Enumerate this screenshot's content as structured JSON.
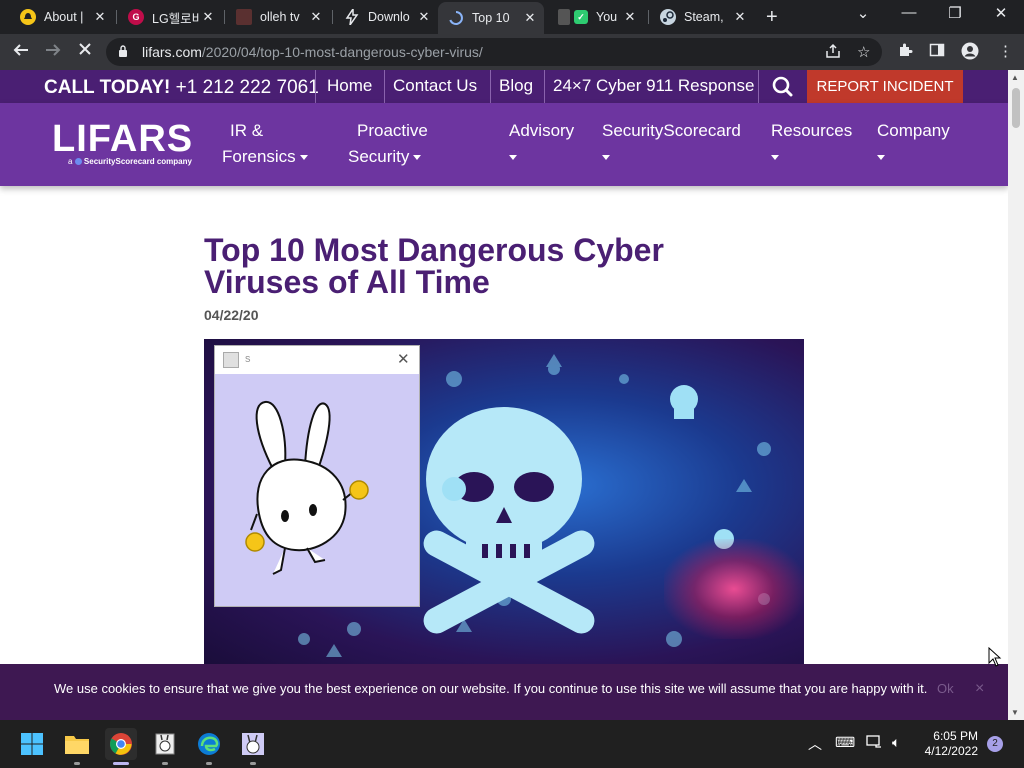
{
  "browser": {
    "tabs": [
      {
        "title": "About |",
        "icon": "bell-icon",
        "color": "#f5c518",
        "active": false
      },
      {
        "title": "LG헬로비",
        "icon": "lg-icon",
        "color": "#c00d4a",
        "active": false
      },
      {
        "title": "olleh tv",
        "icon": "olleh-icon",
        "color": "#c0392b",
        "active": false
      },
      {
        "title": "Downlo",
        "icon": "lightning-icon",
        "color": "#e8eaed",
        "active": false
      },
      {
        "title": "Top 10",
        "icon": "loading-icon",
        "color": "#8ab4f8",
        "active": true
      },
      {
        "title": "You",
        "icon": "check-icon",
        "color": "#2ecc71",
        "active": false
      },
      {
        "title": "Steam,",
        "icon": "steam-icon",
        "color": "#1b2838",
        "active": false
      }
    ],
    "url_host": "lifars.com",
    "url_path": "/2020/04/top-10-most-dangerous-cyber-virus/"
  },
  "site": {
    "call_today": "CALL TODAY!",
    "phone": "+1 212 222 7061",
    "top_links": [
      "Home",
      "Contact Us",
      "Blog",
      "24×7 Cyber 911 Response"
    ],
    "report_label": "REPORT INCIDENT",
    "logo": "LIFARS",
    "logo_sub_prefix": "a",
    "logo_sub": "SecurityScorecard company",
    "nav": [
      {
        "line1": "IR &",
        "line2": "Forensics"
      },
      {
        "line1": "Proactive",
        "line2": "Security"
      },
      {
        "line1": "Advisory",
        "line2": ""
      },
      {
        "line1": "SecurityScorecard",
        "line2": ""
      },
      {
        "line1": "Resources",
        "line2": ""
      },
      {
        "line1": "Company",
        "line2": ""
      }
    ]
  },
  "article": {
    "title": "Top 10 Most Dangerous Cyber Viruses of All Time",
    "date": "04/22/20"
  },
  "pet_window": {
    "title": "s"
  },
  "cookie": {
    "text": "We use cookies to ensure that we give you the best experience on our website. If you continue to use this site we will assume that you are happy with it.",
    "ok": "Ok",
    "close": "×"
  },
  "taskbar": {
    "time": "6:05 PM",
    "date": "4/12/2022",
    "notifications": "2"
  },
  "colors": {
    "topbar": "#4a1f73",
    "nav": "#6d35a0",
    "report": "#c0392b",
    "title": "#4a1f73"
  }
}
